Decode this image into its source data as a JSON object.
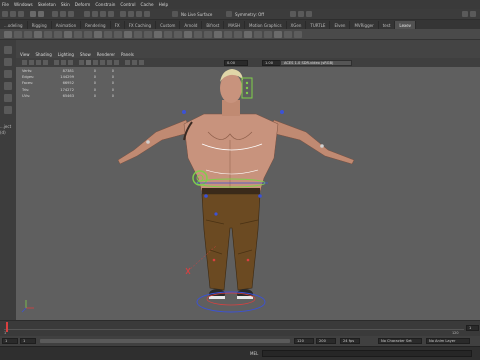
{
  "menus": [
    "File",
    "Windows",
    "Skeleton",
    "Skin",
    "Deform",
    "Constrain",
    "Control",
    "Cache",
    "Help"
  ],
  "statusline": {
    "live_surface_label": "No Live Surface",
    "symmetry_label": "Symmetry: Off"
  },
  "shelf_tabs": [
    "...odeling",
    "Rigging",
    "Animation",
    "Rendering",
    "FX",
    "FX Caching",
    "Custom",
    "Arnold",
    "Bifrost",
    "MASH",
    "Motion Graphics",
    "XGen",
    "TURTLE",
    "Elven",
    "MVRigger",
    "test",
    "Lexev"
  ],
  "shelf_active_tab": "Lexev",
  "viewport_menu": [
    "View",
    "Shading",
    "Lighting",
    "Show",
    "Renderer",
    "Panels"
  ],
  "viewport_toolbar": {
    "value_a": "0.00",
    "value_b": "1.00",
    "color_space": "ACES 1.0 SDR-video (sRGB)"
  },
  "left_edge_text": [
    "...ject",
    "(d)"
  ],
  "hud_stats": [
    {
      "label": "Verts:",
      "v1": "87381",
      "v2": "0",
      "v3": "0"
    },
    {
      "label": "Edges:",
      "v1": "144299",
      "v2": "0",
      "v3": "0"
    },
    {
      "label": "Faces:",
      "v1": "66952",
      "v2": "0",
      "v3": "0"
    },
    {
      "label": "Tris:",
      "v1": "174272",
      "v2": "0",
      "v3": "0"
    },
    {
      "label": "UVs:",
      "v1": "65463",
      "v2": "0",
      "v3": "0"
    }
  ],
  "timeline": {
    "start": "1",
    "end": "120",
    "current_frame": "1",
    "range_start": "1",
    "range_end": "120",
    "range_end_2": "200",
    "fps": "24 fps",
    "character_set": "No Character Set",
    "anim_layer": "No Anim Layer"
  },
  "command_line": {
    "label": "MEL"
  },
  "colors": {
    "viewport_bg": "#5f5f5f",
    "skin": "#c8937d",
    "pants": "#6b4a22",
    "control_green": "#7fd04a",
    "control_blue": "#3b52d6",
    "control_red": "#d94040"
  }
}
